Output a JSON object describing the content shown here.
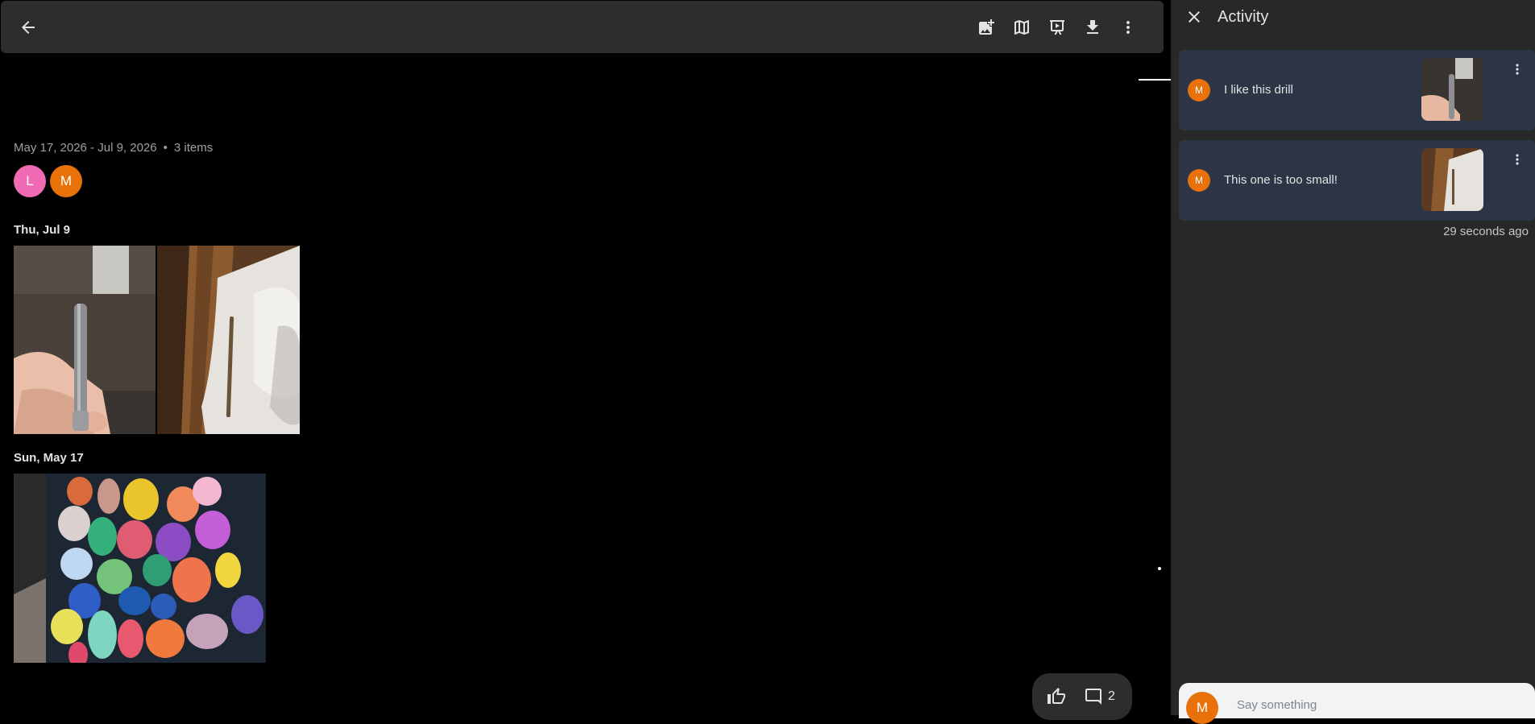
{
  "album": {
    "date_range": "May 17, 2026 - Jul 9, 2026",
    "separator": "•",
    "item_count": "3 items",
    "contributors": [
      {
        "initial": "L",
        "color": "#f06ab4"
      },
      {
        "initial": "M",
        "color": "#e8710a"
      }
    ]
  },
  "toolbar": {
    "icons": [
      "arrow-back-icon",
      "add-photo-icon",
      "map-icon",
      "slideshow-icon",
      "download-icon",
      "more-vert-icon"
    ]
  },
  "sections": [
    {
      "date": "Thu, Jul 9"
    },
    {
      "date": "Sun, May 17"
    }
  ],
  "reactions": {
    "comment_count": "2"
  },
  "activity": {
    "title": "Activity",
    "comments": [
      {
        "initial": "M",
        "text": "I like this drill"
      },
      {
        "initial": "M",
        "text": "This one is too small!"
      }
    ],
    "timestamp": "29 seconds ago",
    "input": {
      "initial": "M",
      "placeholder": "Say something"
    }
  },
  "colors": {
    "accent_avatar_m": "#e8710a",
    "accent_avatar_l": "#f06ab4",
    "card_bg": "#2b3546",
    "panel_bg": "#282828"
  }
}
